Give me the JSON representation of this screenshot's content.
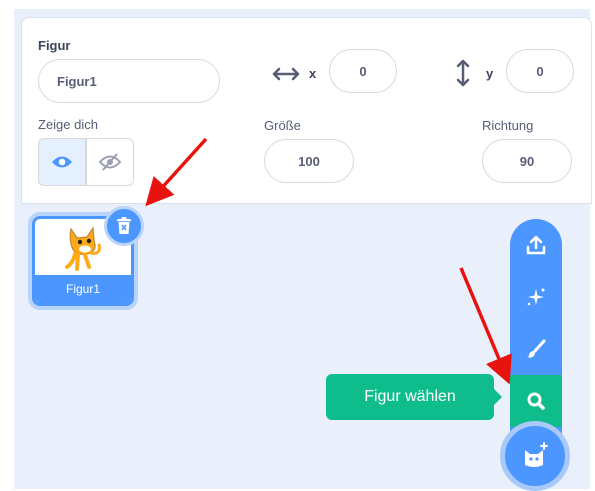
{
  "figure": {
    "section_label": "Figur",
    "name_value": "Figur1",
    "x_label": "x",
    "x_value": "0",
    "y_label": "y",
    "y_value": "0",
    "show_label": "Zeige dich",
    "size_label": "Größe",
    "size_value": "100",
    "direction_label": "Richtung",
    "direction_value": "90"
  },
  "sprites": [
    {
      "name": "Figur1",
      "selected": true
    }
  ],
  "sprite_menu": {
    "items": [
      "upload-icon",
      "surprise-icon",
      "paint-icon",
      "search-icon"
    ],
    "tooltip": "Figur wählen",
    "main_icon": "cat-icon"
  },
  "colors": {
    "accent_blue": "#4c97ff",
    "active_green": "#0fbd8c",
    "arrow_red": "#e8120f"
  }
}
